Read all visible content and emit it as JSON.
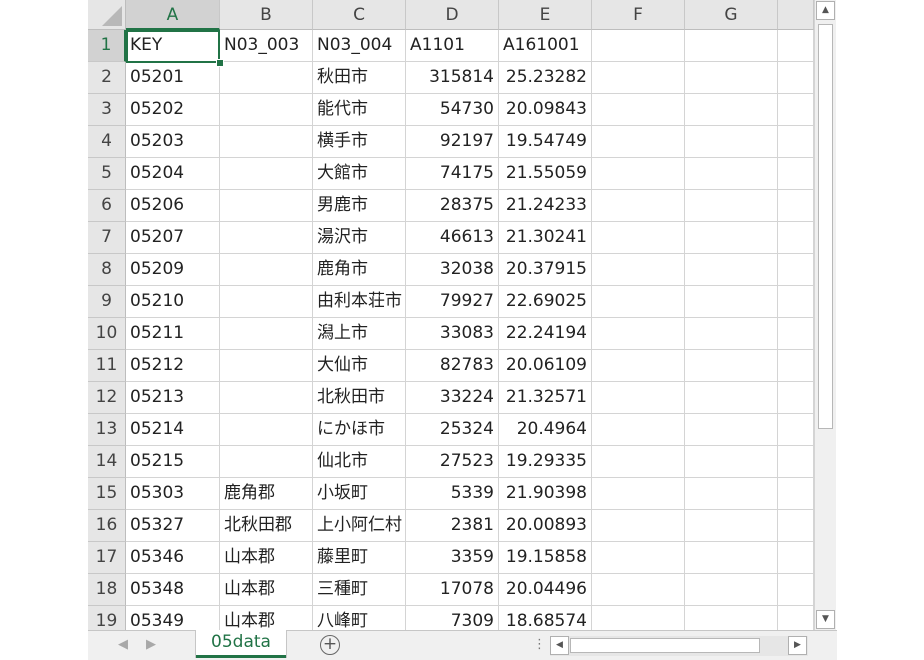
{
  "sheet": {
    "columns": [
      "A",
      "B",
      "C",
      "D",
      "E",
      "F",
      "G"
    ],
    "active_cell": "A1",
    "rows": [
      {
        "row": "1",
        "a": "KEY",
        "b": "N03_003",
        "c": "N03_004",
        "d": "A1101",
        "e": "A161001"
      },
      {
        "row": "2",
        "a": "05201",
        "b": "",
        "c": "秋田市",
        "d": "315814",
        "e": "25.23282"
      },
      {
        "row": "3",
        "a": "05202",
        "b": "",
        "c": "能代市",
        "d": "54730",
        "e": "20.09843"
      },
      {
        "row": "4",
        "a": "05203",
        "b": "",
        "c": "横手市",
        "d": "92197",
        "e": "19.54749"
      },
      {
        "row": "5",
        "a": "05204",
        "b": "",
        "c": "大館市",
        "d": "74175",
        "e": "21.55059"
      },
      {
        "row": "6",
        "a": "05206",
        "b": "",
        "c": "男鹿市",
        "d": "28375",
        "e": "21.24233"
      },
      {
        "row": "7",
        "a": "05207",
        "b": "",
        "c": "湯沢市",
        "d": "46613",
        "e": "21.30241"
      },
      {
        "row": "8",
        "a": "05209",
        "b": "",
        "c": "鹿角市",
        "d": "32038",
        "e": "20.37915"
      },
      {
        "row": "9",
        "a": "05210",
        "b": "",
        "c": "由利本荘市",
        "d": "79927",
        "e": "22.69025"
      },
      {
        "row": "10",
        "a": "05211",
        "b": "",
        "c": "潟上市",
        "d": "33083",
        "e": "22.24194"
      },
      {
        "row": "11",
        "a": "05212",
        "b": "",
        "c": "大仙市",
        "d": "82783",
        "e": "20.06109"
      },
      {
        "row": "12",
        "a": "05213",
        "b": "",
        "c": "北秋田市",
        "d": "33224",
        "e": "21.32571"
      },
      {
        "row": "13",
        "a": "05214",
        "b": "",
        "c": "にかほ市",
        "d": "25324",
        "e": "20.4964"
      },
      {
        "row": "14",
        "a": "05215",
        "b": "",
        "c": "仙北市",
        "d": "27523",
        "e": "19.29335"
      },
      {
        "row": "15",
        "a": "05303",
        "b": "鹿角郡",
        "c": "小坂町",
        "d": "5339",
        "e": "21.90398"
      },
      {
        "row": "16",
        "a": "05327",
        "b": "北秋田郡",
        "c": "上小阿仁村",
        "d": "2381",
        "e": "20.00893"
      },
      {
        "row": "17",
        "a": "05346",
        "b": "山本郡",
        "c": "藤里町",
        "d": "3359",
        "e": "19.15858"
      },
      {
        "row": "18",
        "a": "05348",
        "b": "山本郡",
        "c": "三種町",
        "d": "17078",
        "e": "20.04496"
      },
      {
        "row": "19",
        "a": "05349",
        "b": "山本郡",
        "c": "八峰町",
        "d": "7309",
        "e": "18.68574"
      }
    ]
  },
  "tabs": {
    "sheet_name": "05data",
    "add_label": "+",
    "prev_label": "◀",
    "next_label": "▶",
    "separator": "⋮"
  },
  "scroll": {
    "up": "▲",
    "down": "▼",
    "left": "◀",
    "right": "▶"
  },
  "colors": {
    "accent": "#217346",
    "header_bg": "#e6e6e6",
    "grid": "#d4d4d4"
  }
}
